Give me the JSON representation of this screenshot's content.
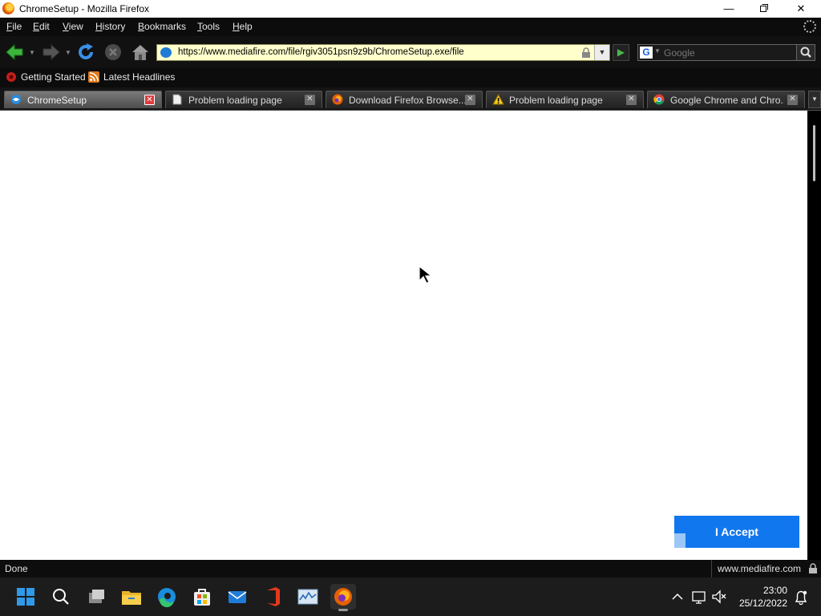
{
  "window": {
    "title": "ChromeSetup - Mozilla Firefox"
  },
  "menu": {
    "items": [
      {
        "key": "F",
        "rest": "ile"
      },
      {
        "key": "E",
        "rest": "dit"
      },
      {
        "key": "V",
        "rest": "iew"
      },
      {
        "key": "H",
        "rest": "istory"
      },
      {
        "key": "B",
        "rest": "ookmarks"
      },
      {
        "key": "T",
        "rest": "ools"
      },
      {
        "key": "H",
        "rest": "elp"
      }
    ]
  },
  "navbar": {
    "url": "https://www.mediafire.com/file/rgiv3051psn9z9b/ChromeSetup.exe/file",
    "search_placeholder": "Google",
    "search_engine_letter": "G"
  },
  "bookmarks": [
    {
      "label": "Getting Started"
    },
    {
      "label": "Latest Headlines"
    }
  ],
  "tabs": [
    {
      "label": "ChromeSetup",
      "active": true,
      "icon": "mediafire-icon"
    },
    {
      "label": "Problem loading page",
      "active": false,
      "icon": "page-icon"
    },
    {
      "label": "Download Firefox Browse...",
      "active": false,
      "icon": "firefox-icon"
    },
    {
      "label": "Problem loading page",
      "active": false,
      "icon": "warning-icon"
    },
    {
      "label": "Google Chrome and Chro...",
      "active": false,
      "icon": "chrome-icon"
    }
  ],
  "page": {
    "accept_button": "I Accept"
  },
  "status": {
    "text": "Done",
    "domain": "www.mediafire.com"
  },
  "clock": {
    "time": "23:00",
    "date": "25/12/2022"
  },
  "colors": {
    "accept": "#1177ee",
    "urlbar": "#ffffcc",
    "active_tab_close": "#e03a3a"
  }
}
